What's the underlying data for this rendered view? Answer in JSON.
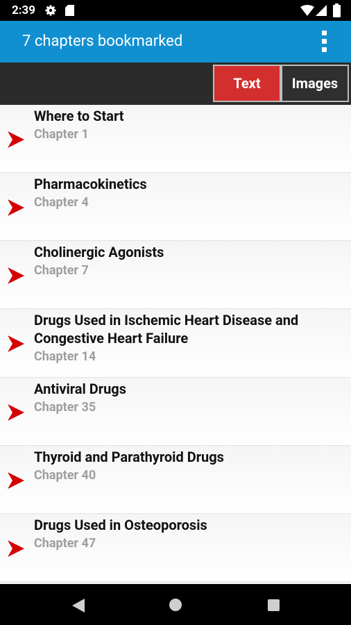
{
  "status_bar": {
    "time": "2:39",
    "icons": [
      "gear-icon",
      "sd-card-icon",
      "wifi-icon",
      "signal-icon",
      "battery-icon"
    ]
  },
  "app_bar": {
    "title": "7 chapters bookmarked",
    "overflow_icon": "more-vert-icon",
    "color": "#1190d1"
  },
  "tabs": {
    "text_label": "Text",
    "images_label": "Images",
    "active": "Text",
    "active_color": "#d32f2f"
  },
  "bookmarks": [
    {
      "title": "Where to Start",
      "chapter": "Chapter 1"
    },
    {
      "title": "Pharmacokinetics",
      "chapter": "Chapter 4"
    },
    {
      "title": "Cholinergic Agonists",
      "chapter": "Chapter 7"
    },
    {
      "title": "Drugs Used in Ischemic Heart Disease and Congestive Heart Failure",
      "chapter": "Chapter 14"
    },
    {
      "title": "Antiviral Drugs",
      "chapter": "Chapter 35"
    },
    {
      "title": "Thyroid and Parathyroid Drugs",
      "chapter": "Chapter 40"
    },
    {
      "title": "Drugs Used in Osteoporosis",
      "chapter": "Chapter 47"
    }
  ],
  "bookmark_icon": "red-arrow-bookmark-icon",
  "nav_bar": {
    "icons": [
      "back-icon",
      "home-icon",
      "recents-icon"
    ]
  }
}
